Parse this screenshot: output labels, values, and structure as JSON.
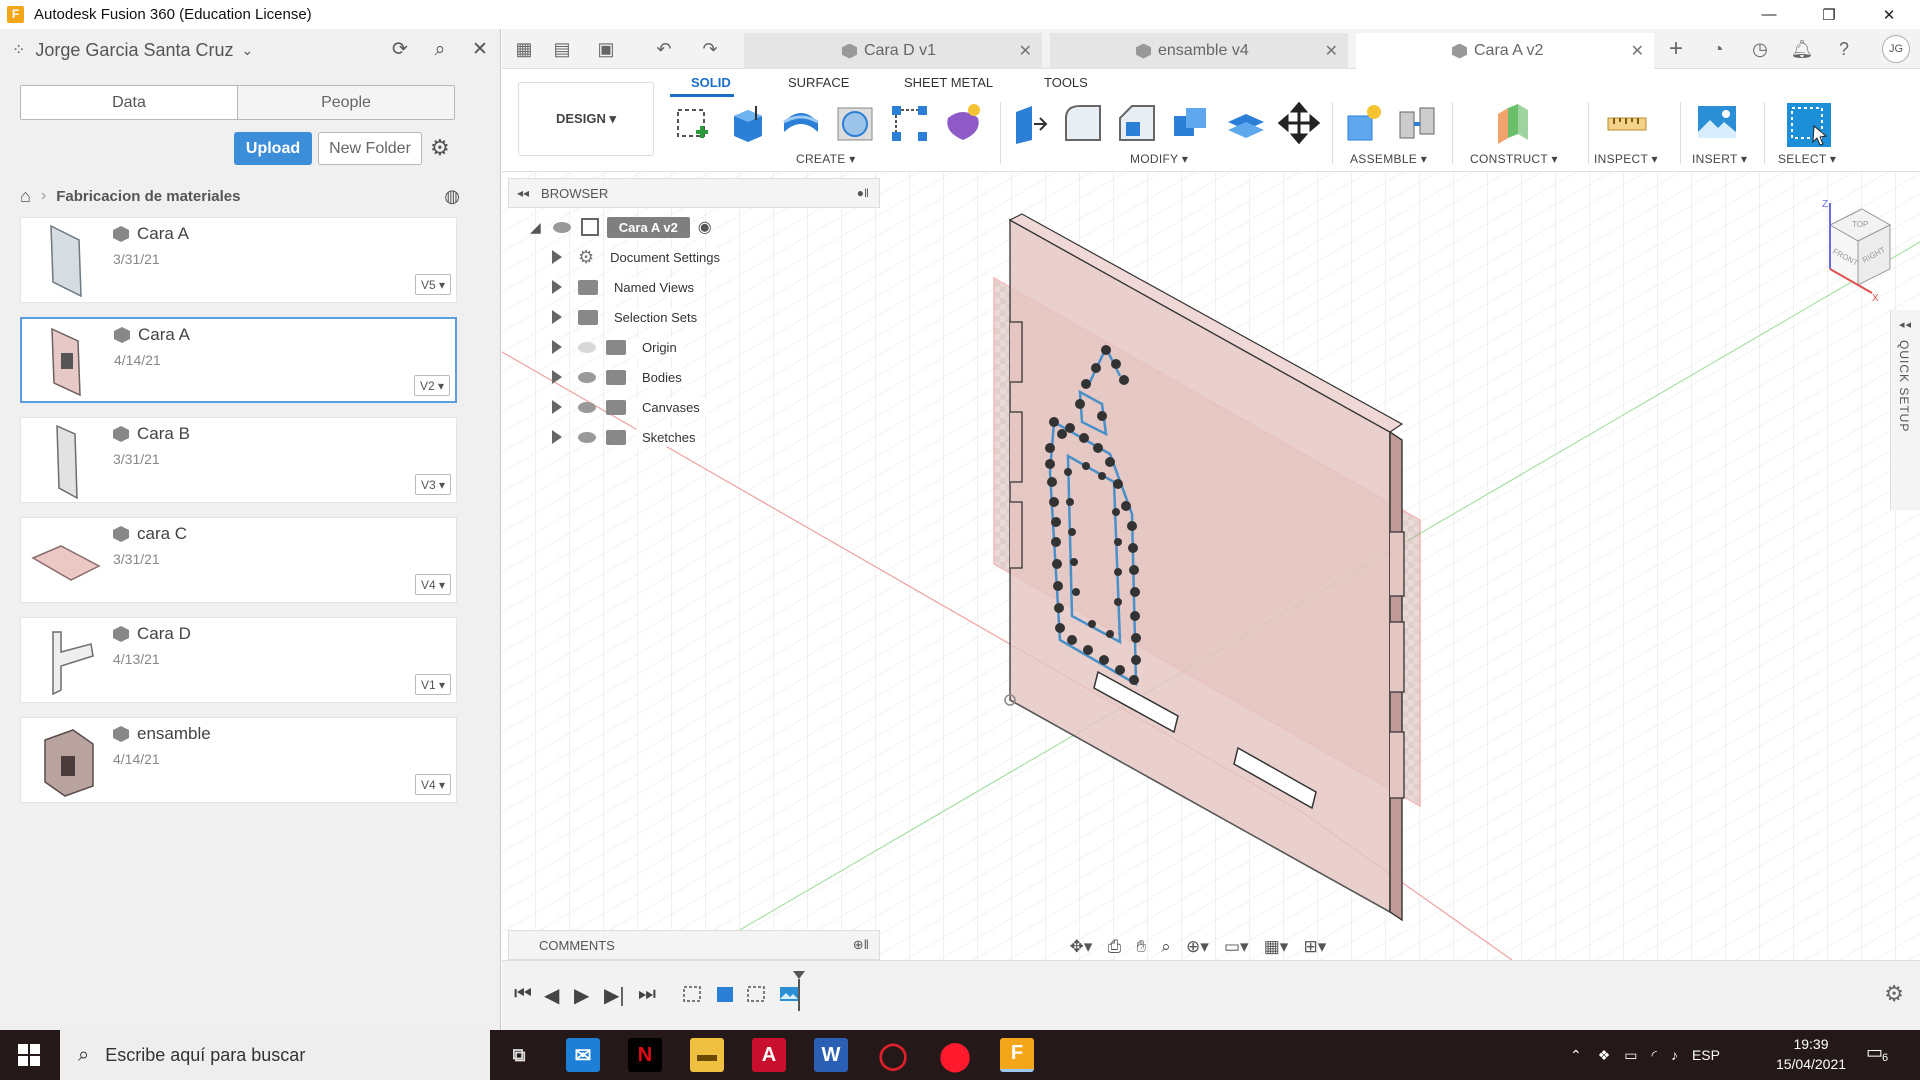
{
  "window": {
    "title": "Autodesk Fusion 360 (Education License)",
    "app_icon": "F"
  },
  "left_panel": {
    "user_name": "Jorge Garcia Santa Cruz",
    "tabs": [
      "Data",
      "People"
    ],
    "upload_label": "Upload",
    "new_folder_label": "New Folder",
    "breadcrumb": "Fabricacion de materiales",
    "files": [
      {
        "name": "Cara A",
        "date": "3/31/21",
        "version": "V5 ▾"
      },
      {
        "name": "Cara A",
        "date": "4/14/21",
        "version": "V2 ▾"
      },
      {
        "name": "Cara B",
        "date": "3/31/21",
        "version": "V3 ▾"
      },
      {
        "name": "cara C",
        "date": "3/31/21",
        "version": "V4 ▾"
      },
      {
        "name": "Cara D",
        "date": "4/13/21",
        "version": "V1 ▾"
      },
      {
        "name": "ensamble",
        "date": "4/14/21",
        "version": "V4 ▾"
      }
    ]
  },
  "doc_tabs": [
    {
      "label": "Cara D v1",
      "active": false
    },
    {
      "label": "ensamble v4",
      "active": false
    },
    {
      "label": "Cara A v2",
      "active": true
    }
  ],
  "avatar_initials": "JG",
  "toolbar": {
    "design_label": "DESIGN ▾",
    "workspace_tabs": [
      "SOLID",
      "SURFACE",
      "SHEET METAL",
      "TOOLS"
    ],
    "groups": [
      "CREATE ▾",
      "MODIFY ▾",
      "ASSEMBLE ▾",
      "CONSTRUCT ▾",
      "INSPECT ▾",
      "INSERT ▾",
      "SELECT ▾"
    ]
  },
  "browser": {
    "header": "BROWSER",
    "root": "Cara A v2",
    "items": [
      "Document Settings",
      "Named Views",
      "Selection Sets",
      "Origin",
      "Bodies",
      "Canvases",
      "Sketches"
    ]
  },
  "comments_label": "COMMENTS",
  "quick_setup_label": "QUICK SETUP",
  "viewcube": {
    "top": "TOP",
    "front": "FRONT",
    "right": "RIGHT",
    "z": "Z",
    "x": "X"
  },
  "taskbar": {
    "search_placeholder": "Escribe aquí para buscar",
    "lang": "ESP",
    "time": "19:39",
    "date": "15/04/2021",
    "notif_count": "6"
  },
  "colors": {
    "accent": "#1b6fc8",
    "upload": "#3d8ed8",
    "body": "#e8c8c4",
    "taskbar": "#241818"
  }
}
